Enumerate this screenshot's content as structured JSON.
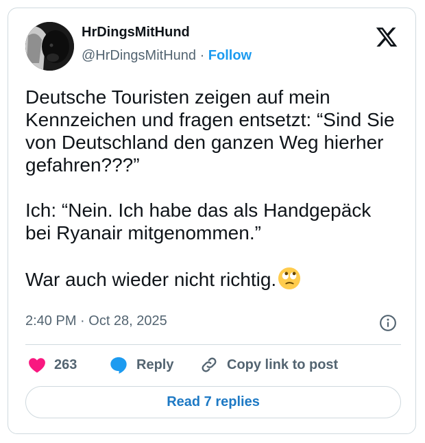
{
  "author": {
    "display_name": "HrDingsMitHund",
    "handle": "@HrDingsMitHund",
    "separator": " · ",
    "follow_label": "Follow",
    "avatar_icon": "dog-avatar"
  },
  "tweet": {
    "text": "Deutsche Touristen zeigen auf mein Kennzeichen und fragen entsetzt: “Sind Sie von Deutschland den ganzen Weg hierher gefahren???”\n\nIch: “Nein. Ich habe das als Handgepäck bei Ryanair mitgenommen.”\n\nWar auch wieder nicht richtig.",
    "emoji_icon": "face-with-rolling-eyes-icon",
    "timestamp": "2:40 PM · Oct 28, 2025"
  },
  "actions": {
    "like_count": "263",
    "reply_label": "Reply",
    "copy_label": "Copy link to post",
    "read_replies_label": "Read 7 replies"
  },
  "colors": {
    "accent": "#1d9bf0",
    "like": "#f91880",
    "muted": "#536471",
    "border": "#cfd9de"
  }
}
